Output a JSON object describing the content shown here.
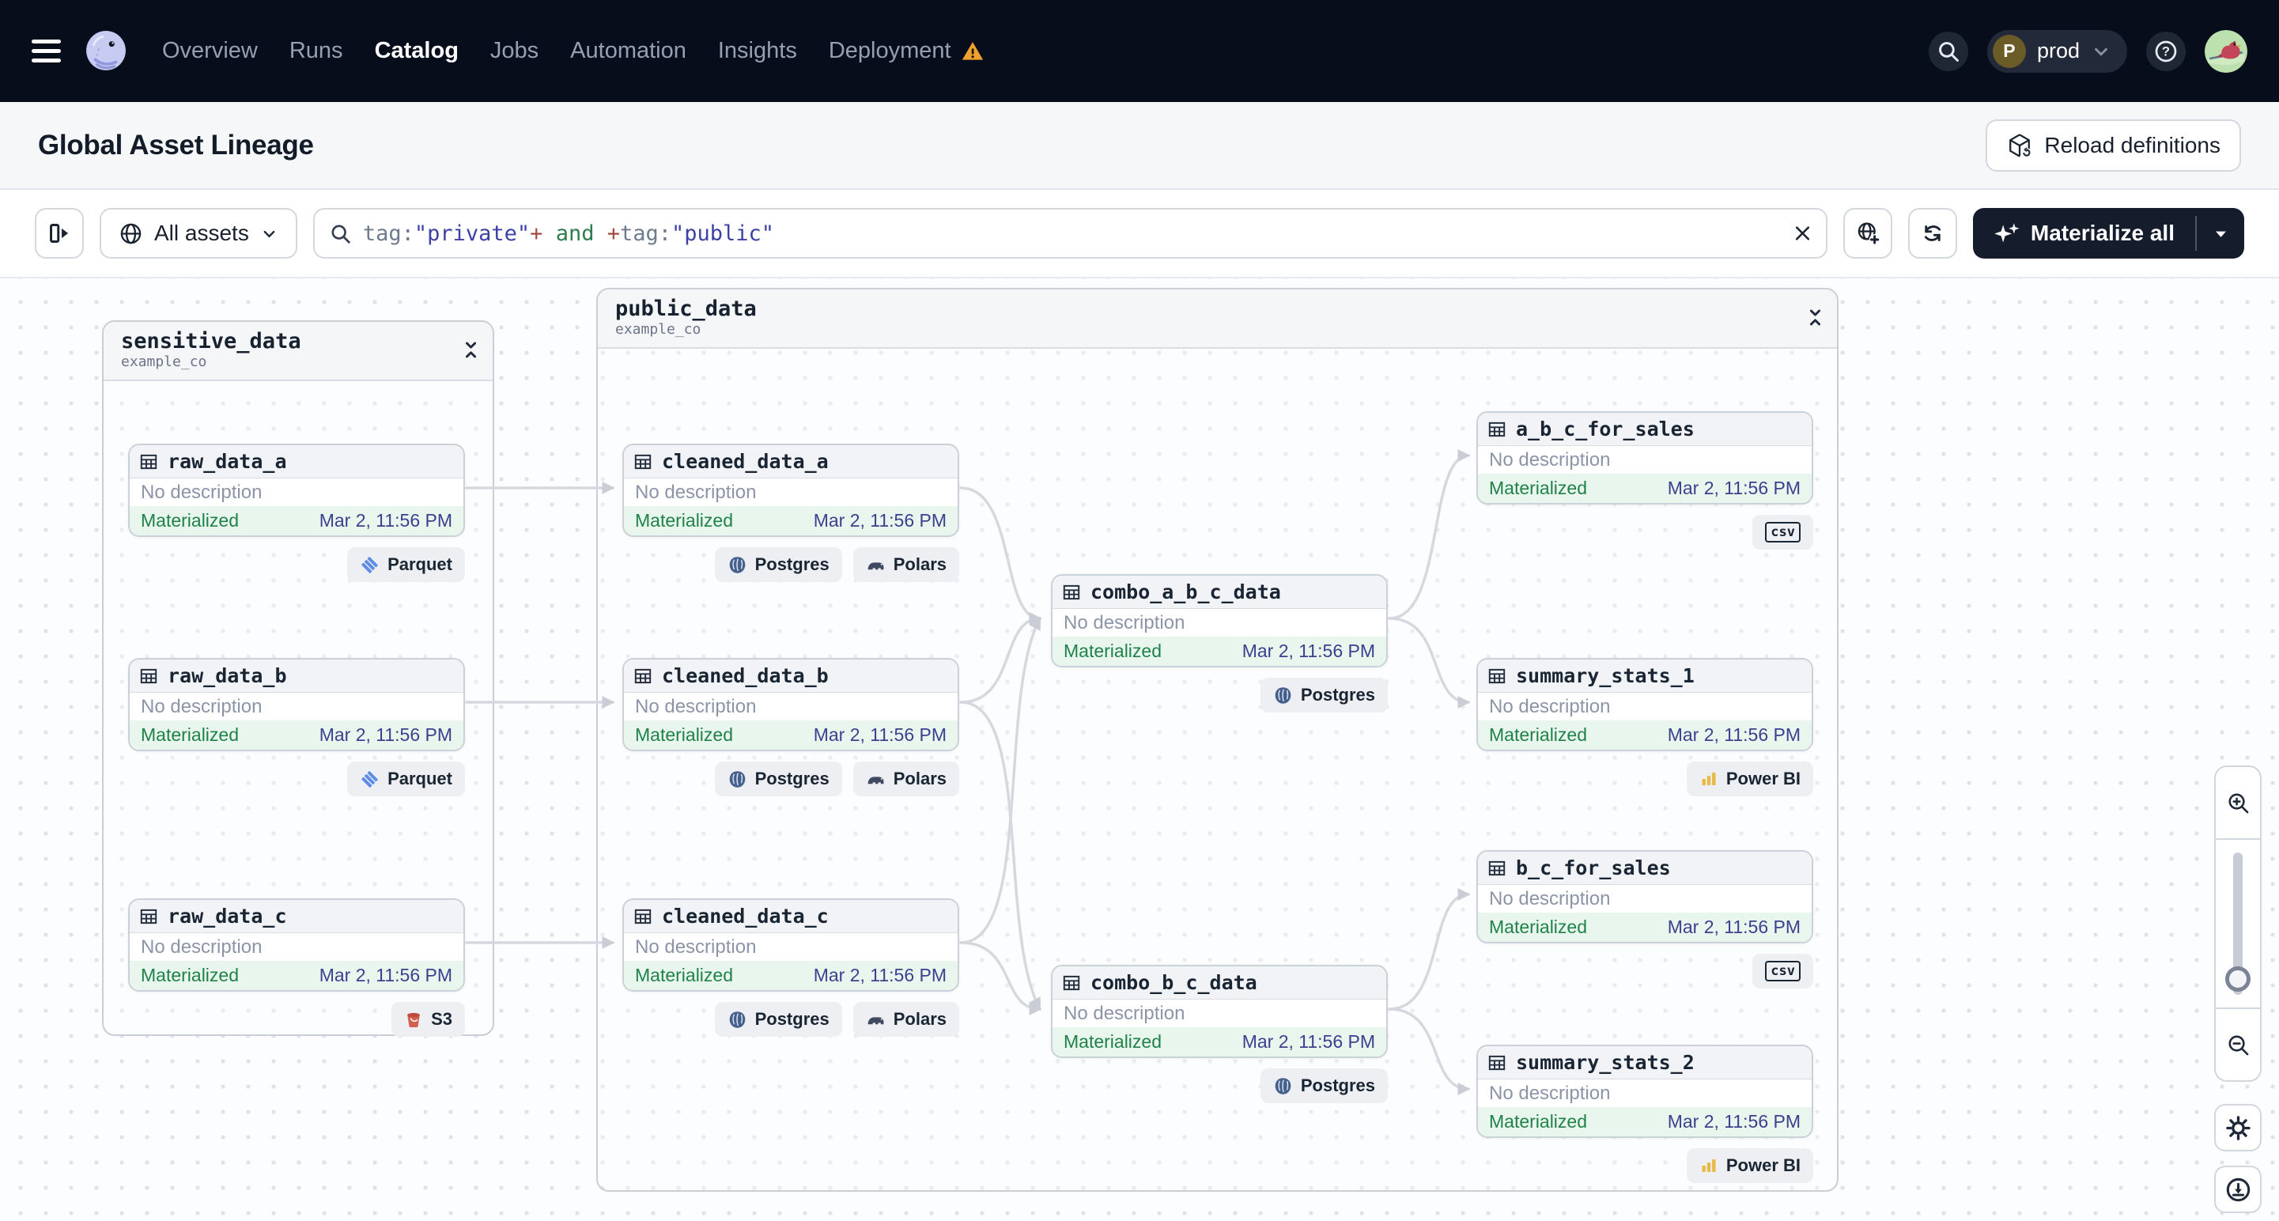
{
  "nav": {
    "items": [
      {
        "label": "Overview",
        "active": false
      },
      {
        "label": "Runs",
        "active": false
      },
      {
        "label": "Catalog",
        "active": true
      },
      {
        "label": "Jobs",
        "active": false
      },
      {
        "label": "Automation",
        "active": false
      },
      {
        "label": "Insights",
        "active": false
      },
      {
        "label": "Deployment",
        "active": false,
        "warning": true
      }
    ],
    "environment": {
      "initial": "P",
      "name": "prod"
    }
  },
  "header": {
    "title": "Global Asset Lineage",
    "reload_label": "Reload definitions"
  },
  "toolbar": {
    "scope_label": "All assets",
    "query": [
      {
        "text": "tag:",
        "kind": "plain"
      },
      {
        "text": "\"private\"",
        "kind": "string"
      },
      {
        "text": "+",
        "kind": "operator"
      },
      {
        "text": " and ",
        "kind": "keyword"
      },
      {
        "text": "+",
        "kind": "operator"
      },
      {
        "text": "tag:",
        "kind": "plain"
      },
      {
        "text": "\"public\"",
        "kind": "string"
      }
    ],
    "materialize_label": "Materialize all"
  },
  "graph": {
    "labels": {
      "no_description": "No description",
      "status": "Materialized",
      "timestamp": "Mar 2, 11:56 PM"
    },
    "groups": [
      {
        "name": "sensitive_data",
        "repo": "example_co"
      },
      {
        "name": "public_data",
        "repo": "example_co"
      }
    ],
    "nodes": [
      {
        "name": "raw_data_a",
        "group": "sensitive_data",
        "tags": [
          {
            "type": "parquet",
            "label": "Parquet"
          }
        ]
      },
      {
        "name": "raw_data_b",
        "group": "sensitive_data",
        "tags": [
          {
            "type": "parquet",
            "label": "Parquet"
          }
        ]
      },
      {
        "name": "raw_data_c",
        "group": "sensitive_data",
        "tags": [
          {
            "type": "s3",
            "label": "S3"
          }
        ]
      },
      {
        "name": "cleaned_data_a",
        "group": "public_data",
        "tags": [
          {
            "type": "postgres",
            "label": "Postgres"
          },
          {
            "type": "polars",
            "label": "Polars"
          }
        ]
      },
      {
        "name": "cleaned_data_b",
        "group": "public_data",
        "tags": [
          {
            "type": "postgres",
            "label": "Postgres"
          },
          {
            "type": "polars",
            "label": "Polars"
          }
        ]
      },
      {
        "name": "cleaned_data_c",
        "group": "public_data",
        "tags": [
          {
            "type": "postgres",
            "label": "Postgres"
          },
          {
            "type": "polars",
            "label": "Polars"
          }
        ]
      },
      {
        "name": "combo_a_b_c_data",
        "group": "public_data",
        "tags": [
          {
            "type": "postgres",
            "label": "Postgres"
          }
        ]
      },
      {
        "name": "combo_b_c_data",
        "group": "public_data",
        "tags": [
          {
            "type": "postgres",
            "label": "Postgres"
          }
        ]
      },
      {
        "name": "a_b_c_for_sales",
        "group": "public_data",
        "tags": [
          {
            "type": "csv",
            "label": "csv"
          }
        ]
      },
      {
        "name": "summary_stats_1",
        "group": "public_data",
        "tags": [
          {
            "type": "powerbi",
            "label": "Power BI"
          }
        ]
      },
      {
        "name": "b_c_for_sales",
        "group": "public_data",
        "tags": [
          {
            "type": "csv",
            "label": "csv"
          }
        ]
      },
      {
        "name": "summary_stats_2",
        "group": "public_data",
        "tags": [
          {
            "type": "powerbi",
            "label": "Power BI"
          }
        ]
      }
    ],
    "edges": [
      [
        "raw_data_a",
        "cleaned_data_a"
      ],
      [
        "raw_data_b",
        "cleaned_data_b"
      ],
      [
        "raw_data_c",
        "cleaned_data_c"
      ],
      [
        "cleaned_data_a",
        "combo_a_b_c_data"
      ],
      [
        "cleaned_data_b",
        "combo_a_b_c_data"
      ],
      [
        "cleaned_data_c",
        "combo_a_b_c_data"
      ],
      [
        "cleaned_data_b",
        "combo_b_c_data"
      ],
      [
        "cleaned_data_c",
        "combo_b_c_data"
      ],
      [
        "combo_a_b_c_data",
        "a_b_c_for_sales"
      ],
      [
        "combo_a_b_c_data",
        "summary_stats_1"
      ],
      [
        "combo_b_c_data",
        "b_c_for_sales"
      ],
      [
        "combo_b_c_data",
        "summary_stats_2"
      ]
    ]
  },
  "icons": {
    "deployment-warning": "warning-triangle",
    "search": "magnifier",
    "help": "question-circle",
    "collapse-group": "chevrons-inward",
    "asset": "table-grid"
  },
  "colors": {
    "topbar_bg": "#080D1C",
    "accent_dark": "#151C2C",
    "materialized_green": "#1F8249",
    "materialized_bg": "#E9F6EE",
    "timestamp_indigo": "#3A418F",
    "warning_orange": "#EFA12D",
    "edge_gray": "#D5D9DF",
    "query_string": "#3B41A5",
    "query_operator": "#A34A42",
    "query_keyword": "#2F7D4C"
  }
}
